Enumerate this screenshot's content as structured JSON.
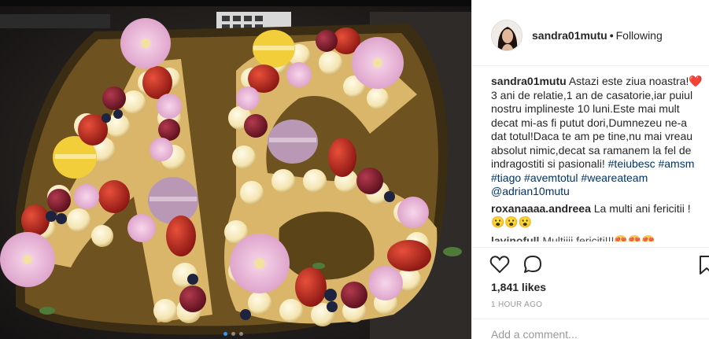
{
  "post": {
    "username": "sandra01mutu",
    "dot": "•",
    "follow_status": "Following",
    "photo_description_icon": "cake-photo",
    "carousel": {
      "count": 3,
      "active_index": 0
    }
  },
  "comments": [
    {
      "user": "sandra01mutu",
      "text": "Astazi este ziua noastra!❤️3 ani de relatie,1 an de casatorie,iar puiul nostru implineste 10 luni.Este mai mult decat mi-as fi putut dori,Dumnezeu ne-a dat totul!Daca te am pe tine,nu mai vreau absolut nimic,decat sa ramanem la fel de indragostiti si pasionali!",
      "tags": [
        "#teiubesc",
        "#amsm",
        "#tiago",
        "#avemtotul",
        "#weareateam",
        "@adrian10mutu"
      ]
    },
    {
      "user": "roxanaaaa.andreea",
      "text": "La multi ani fericitii !😮😮😮"
    },
    {
      "user": "lavinofull",
      "text": "Multiiii fericiti!!!😍😍😍"
    }
  ],
  "actions": {
    "likes": "1,841 likes",
    "time": "1 HOUR AGO",
    "comment_placeholder": "Add a comment..."
  },
  "icons": [
    "heart-icon",
    "comment-icon",
    "bookmark-icon"
  ],
  "colors": {
    "link": "#003569",
    "text": "#262626",
    "muted": "#999999",
    "accent": "#3897f0"
  }
}
